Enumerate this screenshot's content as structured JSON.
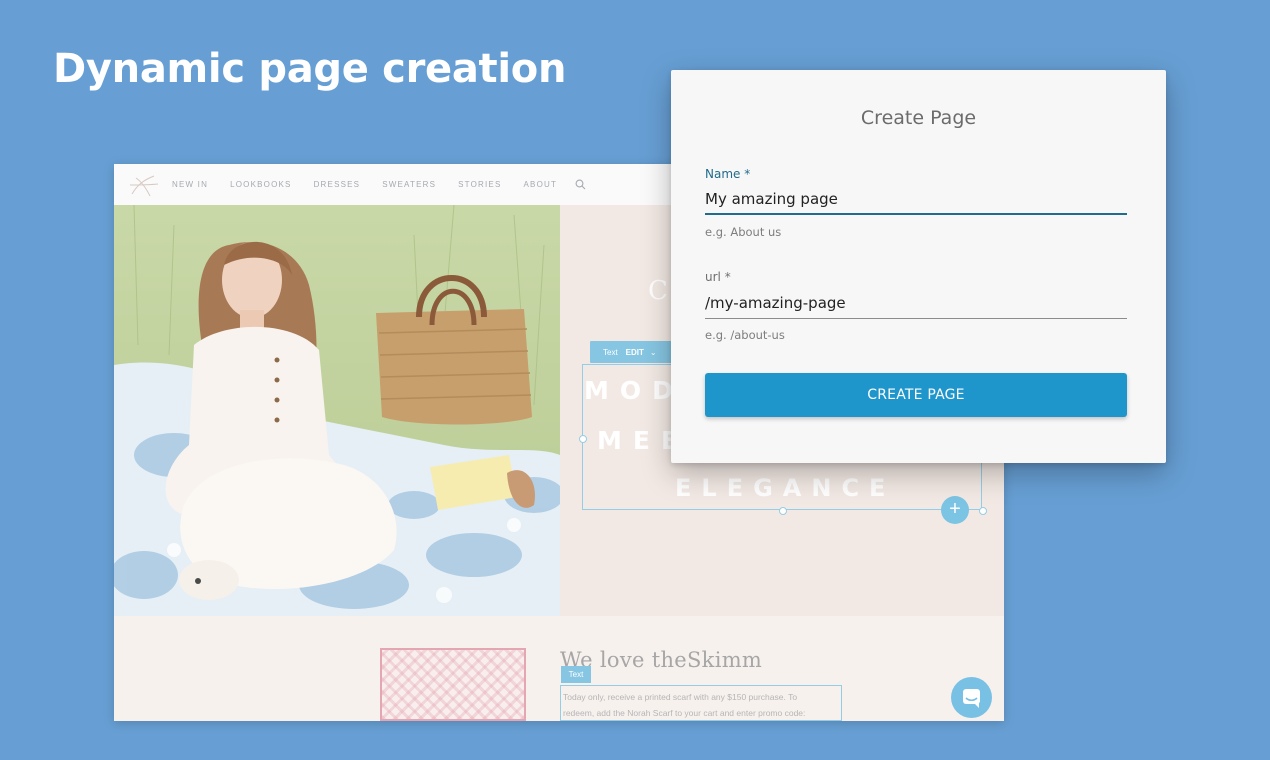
{
  "hero": {
    "title": "Dynamic page creation"
  },
  "site": {
    "nav": [
      "NEW IN",
      "LOOKBOOKS",
      "DRESSES",
      "SWEATERS",
      "STORIES",
      "ABOUT"
    ],
    "toolbar": {
      "label": "Text",
      "edit": "EDIT"
    },
    "hero_text": {
      "lines": [
        "MOD",
        "MEE",
        "ELEGANCE"
      ],
      "script_initial": "C"
    },
    "section": {
      "heading": "We love theSkimm",
      "tag": "Text",
      "body_line1": "Today only, receive a printed scarf with any $150 purchase. To",
      "body_line2": "redeem, add the Norah Scarf to your cart and enter promo code:"
    }
  },
  "modal": {
    "title": "Create Page",
    "name": {
      "label": "Name *",
      "value": "My amazing page",
      "hint": "e.g. About us"
    },
    "url": {
      "label": "url *",
      "value": "/my-amazing-page",
      "hint": "e.g. /about-us"
    },
    "submit": "CREATE PAGE"
  },
  "colors": {
    "background": "#679fd4",
    "accent": "#1e96cb",
    "label_active": "#206c8c"
  }
}
